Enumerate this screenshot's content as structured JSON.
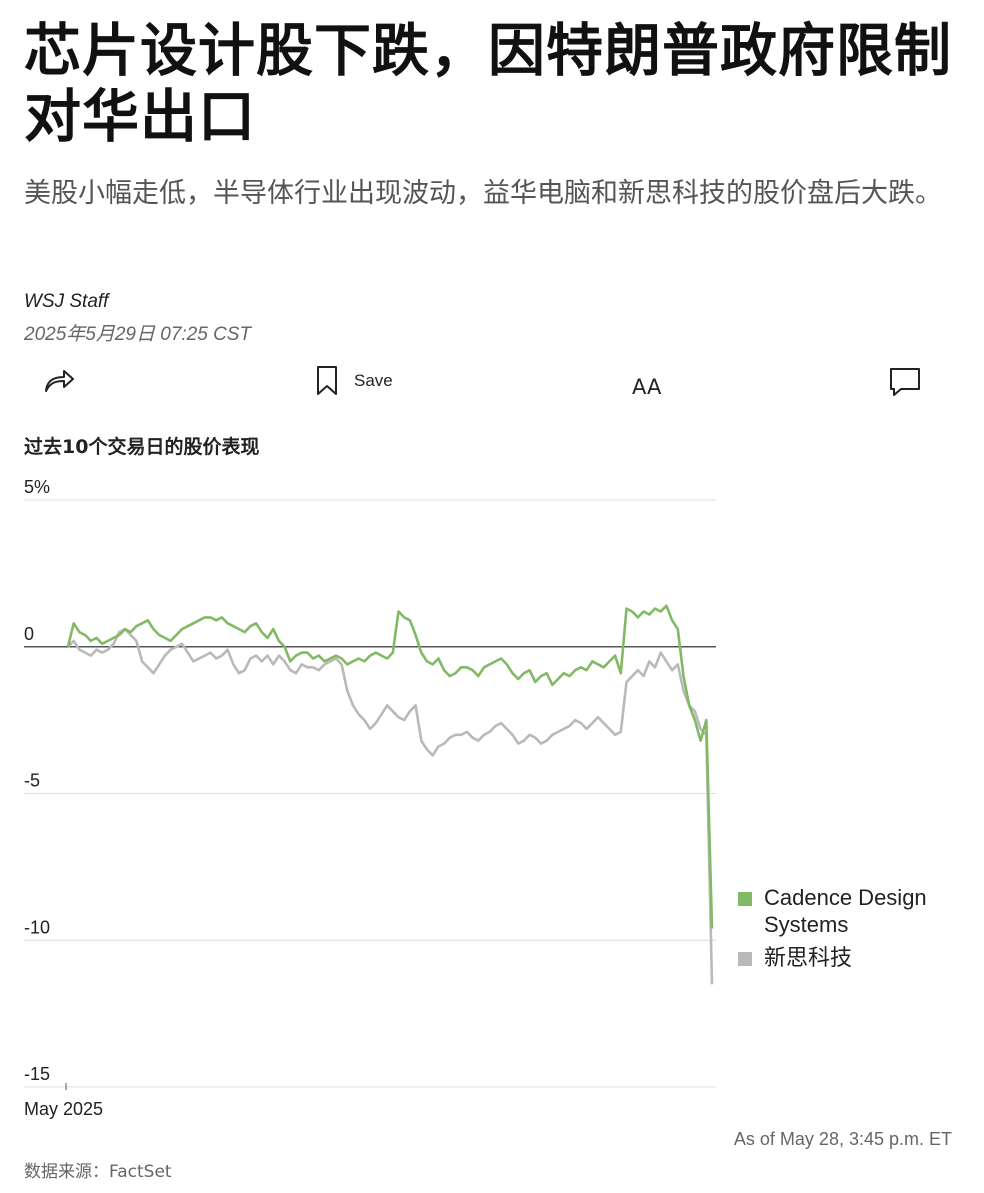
{
  "article": {
    "headline": "芯片设计股下跌，因特朗普政府限制对华出口",
    "dek": "美股小幅走低，半导体行业出现波动，益华电脑和新思科技的股价盘后大跌。",
    "byline": "WSJ Staff",
    "timestamp": "2025年5月29日 07:25 CST"
  },
  "toolbar": {
    "share_icon": "share-arrow-icon",
    "save_icon": "bookmark-icon",
    "save_label": "Save",
    "text_size_icon": "text-size-icon",
    "text_size_glyph": "AA",
    "comment_icon": "comment-bubble-icon"
  },
  "chart_data": {
    "type": "line",
    "title": "过去10个交易日的股价表现",
    "ylim": [
      -15,
      5
    ],
    "y_ticks": [
      5,
      0,
      -5,
      -10,
      -15
    ],
    "y_tick_labels": [
      "5%",
      "0",
      "-5",
      "-10",
      "-15"
    ],
    "x_tick_label": "May 2025",
    "grid": true,
    "legend_position": "right",
    "as_of": "As of May 28, 3:45 p.m. ET",
    "source": "数据来源：FactSet",
    "x": [
      0,
      1,
      2,
      3,
      4,
      5,
      6,
      7,
      8,
      9,
      10,
      11,
      12,
      13,
      14,
      15,
      16,
      17,
      18,
      19,
      20,
      21,
      22,
      23,
      24,
      25,
      26,
      27,
      28,
      29,
      30,
      31,
      32,
      33,
      34,
      35,
      36,
      37,
      38,
      39,
      40,
      41,
      42,
      43,
      44,
      45,
      46,
      47,
      48,
      49,
      50,
      51,
      52,
      53,
      54,
      55,
      56,
      57,
      58,
      59,
      60,
      61,
      62,
      63,
      64,
      65,
      66,
      67,
      68,
      69,
      70,
      71,
      72,
      73,
      74,
      75,
      76,
      77,
      78,
      79,
      80,
      81,
      82,
      83,
      84,
      85,
      86,
      87,
      88,
      89,
      90,
      91,
      92,
      93,
      94,
      95,
      96,
      97,
      98,
      99,
      100,
      101,
      102,
      103,
      104,
      105,
      106,
      107,
      108,
      109,
      110,
      111,
      112,
      113
    ],
    "series": [
      {
        "name": "Cadence Design Systems",
        "color": "#82b965",
        "values": [
          0,
          0.8,
          0.5,
          0.4,
          0.2,
          0.3,
          0.1,
          0.2,
          0.3,
          0.4,
          0.6,
          0.5,
          0.7,
          0.8,
          0.9,
          0.6,
          0.4,
          0.3,
          0.2,
          0.4,
          0.6,
          0.7,
          0.8,
          0.9,
          1.0,
          1.0,
          0.9,
          1.0,
          0.8,
          0.7,
          0.6,
          0.5,
          0.7,
          0.8,
          0.5,
          0.3,
          0.6,
          0.2,
          0.0,
          -0.5,
          -0.3,
          -0.2,
          -0.2,
          -0.4,
          -0.3,
          -0.5,
          -0.4,
          -0.3,
          -0.4,
          -0.6,
          -0.5,
          -0.4,
          -0.5,
          -0.3,
          -0.2,
          -0.3,
          -0.4,
          -0.2,
          1.2,
          1.0,
          0.9,
          0.4,
          -0.2,
          -0.5,
          -0.6,
          -0.4,
          -0.8,
          -1.0,
          -0.9,
          -0.7,
          -0.7,
          -0.8,
          -1.0,
          -0.7,
          -0.6,
          -0.5,
          -0.4,
          -0.6,
          -0.9,
          -1.1,
          -0.9,
          -0.8,
          -1.2,
          -1.0,
          -0.9,
          -1.3,
          -1.1,
          -0.9,
          -1.0,
          -0.8,
          -0.7,
          -0.8,
          -0.5,
          -0.6,
          -0.7,
          -0.5,
          -0.3,
          -0.9,
          1.3,
          1.2,
          1.0,
          1.2,
          1.1,
          1.3,
          1.2,
          1.4,
          0.9,
          0.6,
          -1.0,
          -2.0,
          -2.5,
          -3.2,
          -2.5,
          -9.6
        ]
      },
      {
        "name": "新思科技",
        "color": "#b9b9b9",
        "values": [
          0,
          0.2,
          -0.1,
          -0.2,
          -0.3,
          -0.1,
          -0.2,
          -0.1,
          0.1,
          0.5,
          0.6,
          0.4,
          0.2,
          -0.5,
          -0.7,
          -0.9,
          -0.6,
          -0.3,
          -0.1,
          0.0,
          0.1,
          -0.2,
          -0.5,
          -0.4,
          -0.3,
          -0.2,
          -0.4,
          -0.3,
          -0.1,
          -0.6,
          -0.9,
          -0.8,
          -0.4,
          -0.3,
          -0.5,
          -0.3,
          -0.6,
          -0.3,
          -0.5,
          -0.8,
          -0.9,
          -0.6,
          -0.7,
          -0.7,
          -0.8,
          -0.6,
          -0.5,
          -0.4,
          -0.6,
          -1.5,
          -2.0,
          -2.3,
          -2.5,
          -2.8,
          -2.6,
          -2.3,
          -2.0,
          -2.2,
          -2.4,
          -2.5,
          -2.2,
          -2.0,
          -3.2,
          -3.5,
          -3.7,
          -3.4,
          -3.3,
          -3.1,
          -3.0,
          -3.0,
          -2.9,
          -3.1,
          -3.2,
          -3.0,
          -2.9,
          -2.7,
          -2.6,
          -2.8,
          -3.0,
          -3.3,
          -3.2,
          -3.0,
          -3.1,
          -3.3,
          -3.2,
          -3.0,
          -2.9,
          -2.8,
          -2.7,
          -2.5,
          -2.6,
          -2.8,
          -2.6,
          -2.4,
          -2.6,
          -2.8,
          -3.0,
          -2.9,
          -1.2,
          -1.0,
          -0.8,
          -1.0,
          -0.5,
          -0.7,
          -0.2,
          -0.5,
          -0.8,
          -0.6,
          -1.5,
          -2.0,
          -2.2,
          -2.8,
          -3.0,
          -11.5
        ]
      }
    ]
  }
}
